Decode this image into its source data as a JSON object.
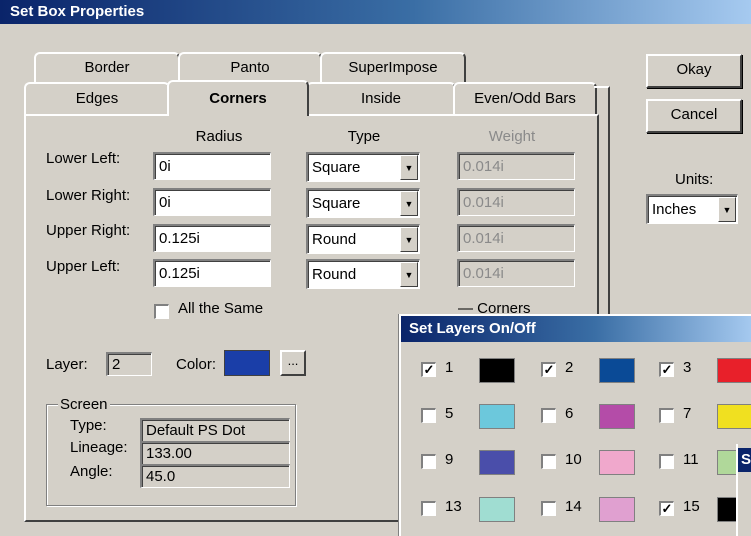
{
  "window": {
    "title": "Set Box Properties"
  },
  "tabs": {
    "back": [
      "Border",
      "Panto",
      "SuperImpose"
    ],
    "front": [
      "Edges",
      "Corners",
      "Inside",
      "Even/Odd Bars"
    ],
    "active": "Corners"
  },
  "corners": {
    "headers": {
      "radius": "Radius",
      "type": "Type",
      "weight": "Weight"
    },
    "rows": [
      {
        "label": "Lower Left:",
        "radius": "0i",
        "type": "Square",
        "weight": "0.014i"
      },
      {
        "label": "Lower Right:",
        "radius": "0i",
        "type": "Square",
        "weight": "0.014i"
      },
      {
        "label": "Upper Right:",
        "radius": "0.125i",
        "type": "Round",
        "weight": "0.014i"
      },
      {
        "label": "Upper Left:",
        "radius": "0.125i",
        "type": "Round",
        "weight": "0.014i"
      }
    ],
    "all_same": {
      "label": "All the Same",
      "checked": false
    },
    "corners_partial_label": "Corners"
  },
  "layer": {
    "label": "Layer:",
    "value": "2"
  },
  "color": {
    "label": "Color:",
    "value": "#1a3ea8",
    "browse_label": "..."
  },
  "screen": {
    "group_label": "Screen",
    "type_label": "Type:",
    "type_value": "Default PS Dot",
    "lineage_label": "Lineage:",
    "lineage_value": "133.00",
    "angle_label": "Angle:",
    "angle_value": "45.0"
  },
  "buttons": {
    "okay": "Okay",
    "cancel": "Cancel"
  },
  "units": {
    "label": "Units:",
    "value": "Inches"
  },
  "layers_dialog": {
    "title": "Set Layers On/Off",
    "layers": [
      {
        "num": "1",
        "checked": true,
        "color": "#000000"
      },
      {
        "num": "2",
        "checked": true,
        "color": "#0a4a96"
      },
      {
        "num": "3",
        "checked": true,
        "color": "#e8202a"
      },
      {
        "num": "5",
        "checked": false,
        "color": "#6cc8dc"
      },
      {
        "num": "6",
        "checked": false,
        "color": "#b44ca8"
      },
      {
        "num": "7",
        "checked": false,
        "color": "#f0e020"
      },
      {
        "num": "9",
        "checked": false,
        "color": "#4a4eaa"
      },
      {
        "num": "10",
        "checked": false,
        "color": "#f0a8cc"
      },
      {
        "num": "11",
        "checked": false,
        "color": "#b0d89a"
      },
      {
        "num": "13",
        "checked": false,
        "color": "#a0ddd2"
      },
      {
        "num": "14",
        "checked": false,
        "color": "#e0a0d0"
      },
      {
        "num": "15",
        "checked": true,
        "color": "#000000"
      }
    ],
    "stray_title": "S"
  }
}
